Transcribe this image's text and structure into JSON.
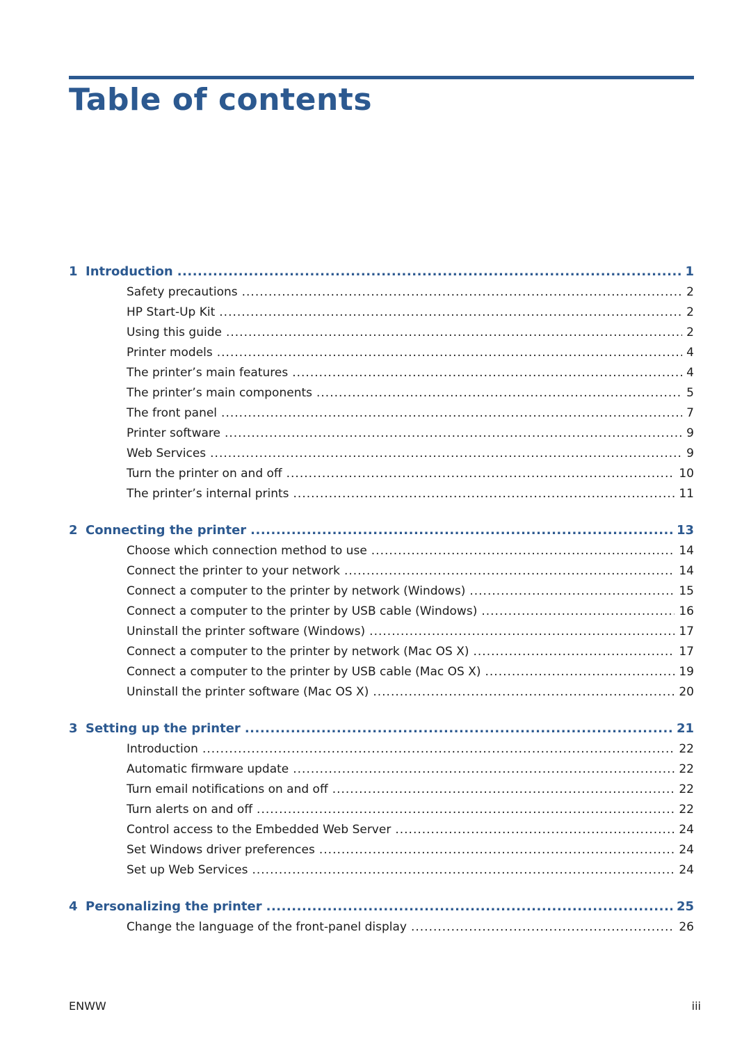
{
  "title": "Table of contents",
  "chapters": [
    {
      "number": "1",
      "title": "Introduction",
      "page": "1",
      "sections": [
        {
          "title": "Safety precautions",
          "page": "2"
        },
        {
          "title": "HP Start-Up Kit",
          "page": "2"
        },
        {
          "title": "Using this guide",
          "page": "2"
        },
        {
          "title": "Printer models",
          "page": "4"
        },
        {
          "title": "The printer’s main features",
          "page": "4"
        },
        {
          "title": "The printer’s main components",
          "page": "5"
        },
        {
          "title": "The front panel",
          "page": "7"
        },
        {
          "title": "Printer software",
          "page": "9"
        },
        {
          "title": "Web Services",
          "page": "9"
        },
        {
          "title": "Turn the printer on and off",
          "page": "10"
        },
        {
          "title": "The printer’s internal prints",
          "page": "11"
        }
      ]
    },
    {
      "number": "2",
      "title": "Connecting the printer",
      "page": "13",
      "sections": [
        {
          "title": "Choose which connection method to use",
          "page": "14"
        },
        {
          "title": "Connect the printer to your network",
          "page": "14"
        },
        {
          "title": "Connect a computer to the printer by network (Windows)",
          "page": "15"
        },
        {
          "title": "Connect a computer to the printer by USB cable (Windows)",
          "page": "16"
        },
        {
          "title": "Uninstall the printer software (Windows)",
          "page": "17"
        },
        {
          "title": "Connect a computer to the printer by network (Mac OS X)",
          "page": "17"
        },
        {
          "title": "Connect a computer to the printer by USB cable (Mac OS X)",
          "page": "19"
        },
        {
          "title": "Uninstall the printer software (Mac OS X)",
          "page": "20"
        }
      ]
    },
    {
      "number": "3",
      "title": "Setting up the printer",
      "page": "21",
      "sections": [
        {
          "title": "Introduction",
          "page": "22"
        },
        {
          "title": "Automatic firmware update",
          "page": "22"
        },
        {
          "title": "Turn email notifications on and off",
          "page": "22"
        },
        {
          "title": "Turn alerts on and off",
          "page": "22"
        },
        {
          "title": "Control access to the Embedded Web Server",
          "page": "24"
        },
        {
          "title": "Set Windows driver preferences",
          "page": "24"
        },
        {
          "title": "Set up Web Services",
          "page": "24"
        }
      ]
    },
    {
      "number": "4",
      "title": "Personalizing the printer",
      "page": "25",
      "sections": [
        {
          "title": "Change the language of the front-panel display",
          "page": "26"
        }
      ]
    }
  ],
  "footer": {
    "left": "ENWW",
    "right": "iii"
  },
  "colors": {
    "accent": "#2c5990",
    "text": "#1c1c1c"
  }
}
